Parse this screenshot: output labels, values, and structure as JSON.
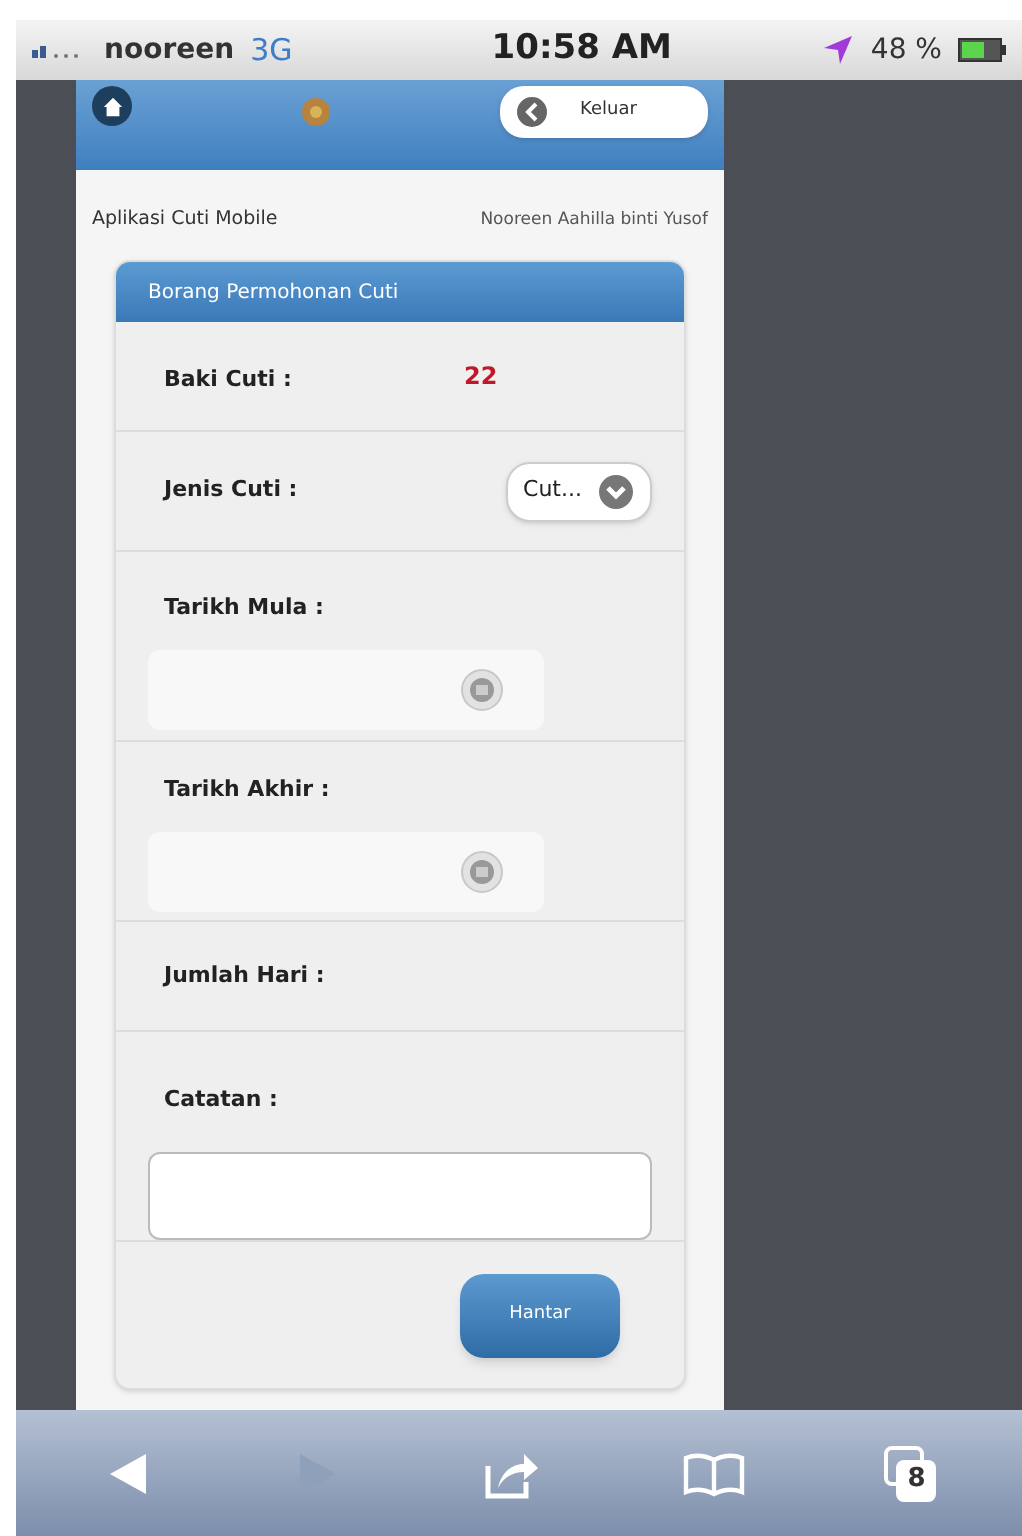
{
  "status_bar": {
    "carrier": "nooreen",
    "network": "3G",
    "time": "10:58 AM",
    "battery": "48 %"
  },
  "header": {
    "logout_button": "Keluar"
  },
  "app_bar": {
    "title": "Aplikasi Cuti Mobile",
    "user": "Nooreen Aahilla binti Yusof"
  },
  "form": {
    "title": "Borang Permohonan Cuti",
    "fields": [
      {
        "kind": "value",
        "label": "Baki Cuti :",
        "value": "22"
      },
      {
        "kind": "select",
        "label": "Jenis Cuti :",
        "value": "Cut..."
      },
      {
        "kind": "date",
        "label": "Tarikh Mula :"
      },
      {
        "kind": "date",
        "label": "Tarikh Akhir :"
      },
      {
        "kind": "text",
        "label": "Jumlah Hari :"
      },
      {
        "kind": "textarea",
        "label": "Catatan :"
      }
    ],
    "submit": "Hantar"
  },
  "toolbar": {
    "buttons": [
      {
        "kind": "back",
        "disabled": false
      },
      {
        "kind": "forward",
        "disabled": true
      },
      {
        "kind": "share",
        "disabled": false
      },
      {
        "kind": "bookmarks",
        "disabled": false
      },
      {
        "kind": "tabs",
        "disabled": false,
        "count": "8"
      }
    ]
  }
}
